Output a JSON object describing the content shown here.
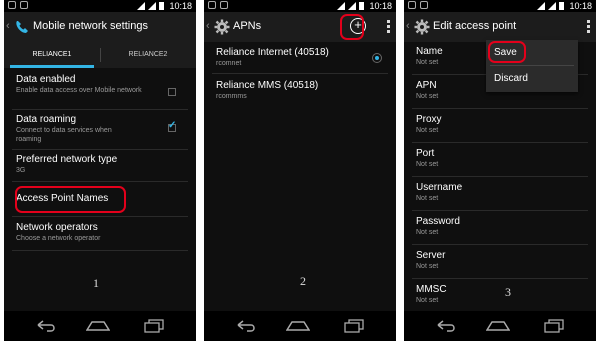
{
  "status": {
    "time": "10:18"
  },
  "screen1": {
    "title": "Mobile network settings",
    "tabs": [
      "RELIANCE1",
      "RELIANCE2"
    ],
    "items": [
      {
        "title": "Data enabled",
        "subtitle": "Enable data access over Mobile network",
        "checked": false
      },
      {
        "title": "Data roaming",
        "subtitle": "Connect to data services when roaming",
        "checked": true
      },
      {
        "title": "Preferred network type",
        "subtitle": "3G"
      },
      {
        "title": "Access Point Names",
        "subtitle": ""
      },
      {
        "title": "Network operators",
        "subtitle": "Choose a network operator"
      }
    ],
    "figure_number": "1"
  },
  "screen2": {
    "title": "APNs",
    "apns": [
      {
        "title": "Reliance Internet (40518)",
        "subtitle": "rcomnet",
        "selected": true
      },
      {
        "title": "Reliance MMS (40518)",
        "subtitle": "rcommms",
        "selected": false
      }
    ],
    "figure_number": "2"
  },
  "screen3": {
    "title": "Edit access point",
    "fields": [
      {
        "title": "Name",
        "value": "Not set"
      },
      {
        "title": "APN",
        "value": "Not set"
      },
      {
        "title": "Proxy",
        "value": "Not set"
      },
      {
        "title": "Port",
        "value": "Not set"
      },
      {
        "title": "Username",
        "value": "Not set"
      },
      {
        "title": "Password",
        "value": "Not set"
      },
      {
        "title": "Server",
        "value": "Not set"
      },
      {
        "title": "MMSC",
        "value": "Not set"
      }
    ],
    "menu": {
      "save": "Save",
      "discard": "Discard"
    },
    "figure_number": "3"
  },
  "icons": {
    "phone": "phone-icon",
    "gear": "gear-icon",
    "add": "add-circle-icon",
    "overflow": "overflow-menu-icon",
    "nav_back": "back-icon",
    "nav_home": "home-icon",
    "nav_recent": "recent-apps-icon"
  },
  "colors": {
    "accent": "#33b5e5",
    "highlight": "#e3001b",
    "background": "#0f0f0f"
  }
}
